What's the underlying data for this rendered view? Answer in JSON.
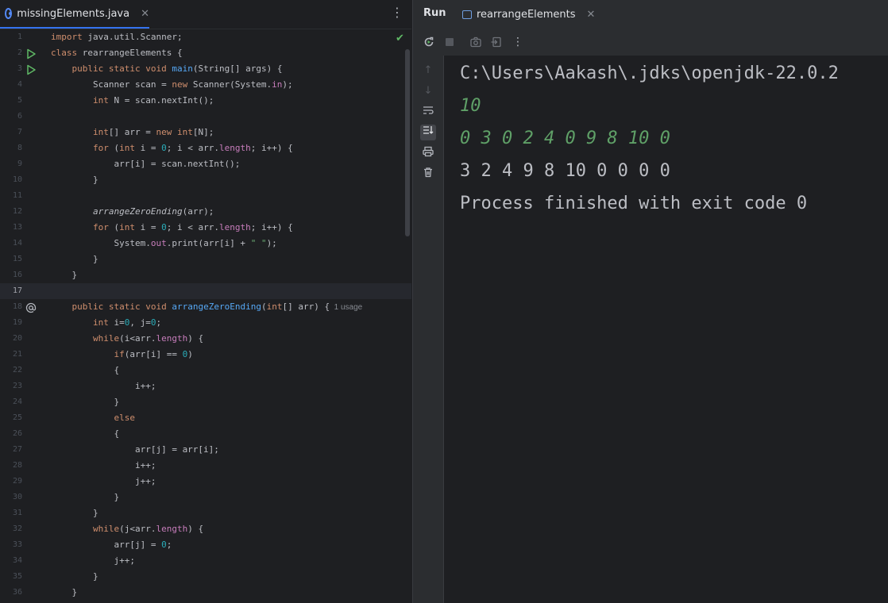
{
  "editor": {
    "tab_label": "missingElements.java",
    "tab_close": "✕",
    "menu_icon": "⋮",
    "check_icon": "✔",
    "usage_hint": "1 usage",
    "lines": [
      {
        "n": "1",
        "text": "import java.util.Scanner;"
      },
      {
        "n": "2",
        "text": "class rearrangeElements {"
      },
      {
        "n": "3",
        "text": "    public static void main(String[] args) {"
      },
      {
        "n": "4",
        "text": "        Scanner scan = new Scanner(System.in);"
      },
      {
        "n": "5",
        "text": "        int N = scan.nextInt();"
      },
      {
        "n": "6",
        "text": ""
      },
      {
        "n": "7",
        "text": "        int[] arr = new int[N];"
      },
      {
        "n": "8",
        "text": "        for (int i = 0; i < arr.length; i++) {"
      },
      {
        "n": "9",
        "text": "            arr[i] = scan.nextInt();"
      },
      {
        "n": "10",
        "text": "        }"
      },
      {
        "n": "11",
        "text": ""
      },
      {
        "n": "12",
        "text": "        arrangeZeroEnding(arr);"
      },
      {
        "n": "13",
        "text": "        for (int i = 0; i < arr.length; i++) {"
      },
      {
        "n": "14",
        "text": "            System.out.print(arr[i] + \" \");"
      },
      {
        "n": "15",
        "text": "        }"
      },
      {
        "n": "16",
        "text": "    }"
      },
      {
        "n": "17",
        "text": ""
      },
      {
        "n": "18",
        "text": "    public static void arrangeZeroEnding(int[] arr) {"
      },
      {
        "n": "19",
        "text": "        int i=0, j=0;"
      },
      {
        "n": "20",
        "text": "        while(i<arr.length) {"
      },
      {
        "n": "21",
        "text": "            if(arr[i] == 0)"
      },
      {
        "n": "22",
        "text": "            {"
      },
      {
        "n": "23",
        "text": "                i++;"
      },
      {
        "n": "24",
        "text": "            }"
      },
      {
        "n": "25",
        "text": "            else"
      },
      {
        "n": "26",
        "text": "            {"
      },
      {
        "n": "27",
        "text": "                arr[j] = arr[i];"
      },
      {
        "n": "28",
        "text": "                i++;"
      },
      {
        "n": "29",
        "text": "                j++;"
      },
      {
        "n": "30",
        "text": "            }"
      },
      {
        "n": "31",
        "text": "        }"
      },
      {
        "n": "32",
        "text": "        while(j<arr.length) {"
      },
      {
        "n": "33",
        "text": "            arr[j] = 0;"
      },
      {
        "n": "34",
        "text": "            j++;"
      },
      {
        "n": "35",
        "text": "        }"
      },
      {
        "n": "36",
        "text": "    }"
      }
    ]
  },
  "run": {
    "title": "Run",
    "tab_label": "rearrangeElements",
    "tab_close": "✕",
    "toolbar_icons": [
      "rerun-icon",
      "stop-icon",
      "camera-icon",
      "exit-icon",
      "more-icon"
    ],
    "console": [
      {
        "text": "C:\\Users\\Aakash\\.jdks\\openjdk-22.0.2",
        "kind": "output"
      },
      {
        "text": "10",
        "kind": "input"
      },
      {
        "text": "0 3 0 2 4 0 9 8 10 0",
        "kind": "input"
      },
      {
        "text": "3 2 4 9 8 10 0 0 0 0",
        "kind": "output"
      },
      {
        "text": "Process finished with exit code 0",
        "kind": "output"
      }
    ]
  },
  "colors": {
    "keyword": "#cf8e6d",
    "number": "#2aacb8",
    "method": "#56a8f5",
    "field": "#c77dbb",
    "string": "#6aab73",
    "console_input": "#5fa067",
    "accent": "#3574f0"
  }
}
